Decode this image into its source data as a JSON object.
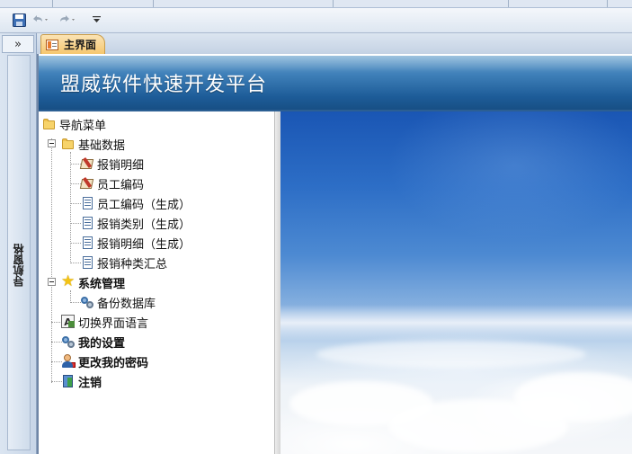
{
  "quick_access": {
    "save_icon": "save-icon",
    "undo_icon": "undo-icon",
    "redo_icon": "redo-icon",
    "customize_icon": "customize-qat-icon"
  },
  "nav_pane": {
    "toggle_label": "»",
    "label": "导航窗格"
  },
  "tabs": [
    {
      "label": "主界面",
      "icon": "form-icon",
      "active": true
    }
  ],
  "header": {
    "title": "盟威软件快速开发平台",
    "colors": {
      "header_top": "#6aa3cf",
      "header_bottom": "#174e83"
    }
  },
  "tree": {
    "root": {
      "label": "导航菜单",
      "icon": "folder-open-icon"
    },
    "items": [
      {
        "label": "基础数据",
        "icon": "folder-open-icon",
        "level": 1,
        "expanded": true,
        "bold": false
      },
      {
        "label": "报销明细",
        "icon": "form-icon",
        "level": 2
      },
      {
        "label": "员工编码",
        "icon": "form-icon",
        "level": 2
      },
      {
        "label": "员工编码（生成）",
        "icon": "report-icon",
        "level": 2
      },
      {
        "label": "报销类别（生成）",
        "icon": "report-icon",
        "level": 2
      },
      {
        "label": "报销明细（生成）",
        "icon": "report-icon",
        "level": 2
      },
      {
        "label": "报销种类汇总",
        "icon": "report-icon",
        "level": 2
      },
      {
        "label": "系统管理",
        "icon": "star-icon",
        "level": 1,
        "expanded": true,
        "bold": true
      },
      {
        "label": "备份数据库",
        "icon": "gear-icon",
        "level": 2
      },
      {
        "label": "切换界面语言",
        "icon": "language-icon",
        "level": 1
      },
      {
        "label": "我的设置",
        "icon": "settings-icon",
        "level": 1,
        "bold": true
      },
      {
        "label": "更改我的密码",
        "icon": "user-key-icon",
        "level": 1,
        "bold": true
      },
      {
        "label": "注销",
        "icon": "logout-icon",
        "level": 1,
        "bold": true
      }
    ]
  },
  "background_image": "sky-clouds-image"
}
